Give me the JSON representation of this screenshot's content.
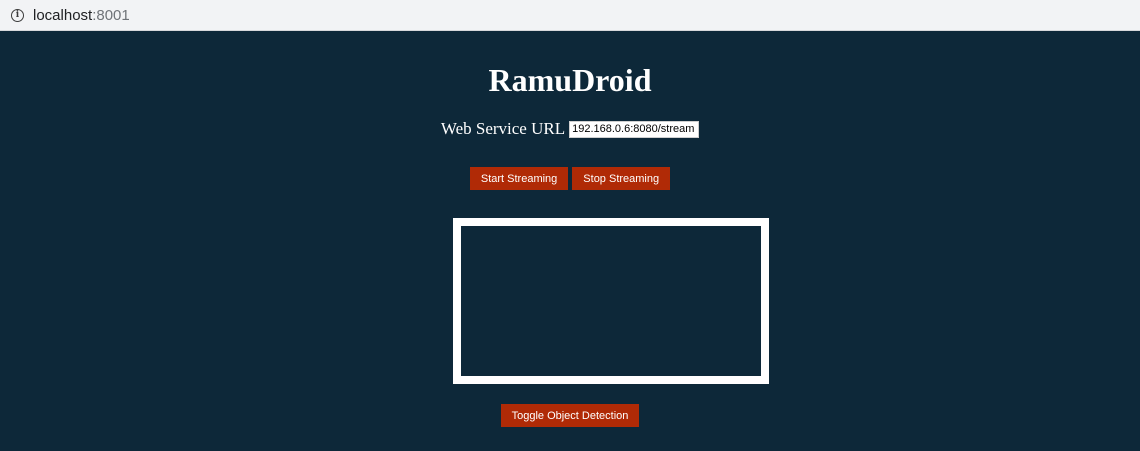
{
  "browser": {
    "url_host": "localhost",
    "url_port": ":8001",
    "info_icon": "info-icon"
  },
  "app": {
    "title": "RamuDroid"
  },
  "service": {
    "label": "Web Service URL",
    "url_value": "192.168.0.6:8080/stream"
  },
  "controls": {
    "start_label": "Start Streaming",
    "stop_label": "Stop Streaming",
    "toggle_label": "Toggle Object Detection"
  },
  "colors": {
    "background": "#0d2839",
    "button": "#b02a06",
    "frame_border": "#ffffff"
  }
}
